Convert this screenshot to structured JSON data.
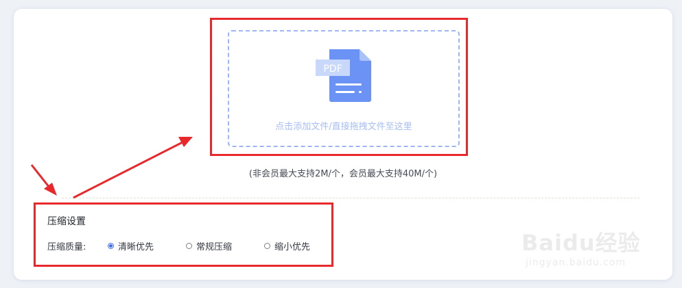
{
  "upload": {
    "icon_text": "PDF",
    "hint": "点击添加文件/直接拖拽文件至这里",
    "size_note": "(非会员最大支持2M/个，会员最大支持40M/个)"
  },
  "settings": {
    "title": "压缩设置",
    "quality_label": "压缩质量:",
    "options": [
      {
        "label": "清晰优先",
        "selected": true
      },
      {
        "label": "常规压缩",
        "selected": false
      },
      {
        "label": "缩小优先",
        "selected": false
      }
    ]
  },
  "watermark": {
    "logo": "Baidu经验",
    "sub": "jingyan.baidu.com"
  },
  "colors": {
    "annotation_red": "#e8282b",
    "accent_blue": "#3c6cf0",
    "upload_border": "#9db4f7",
    "pdf_icon": "#6a93f5"
  }
}
